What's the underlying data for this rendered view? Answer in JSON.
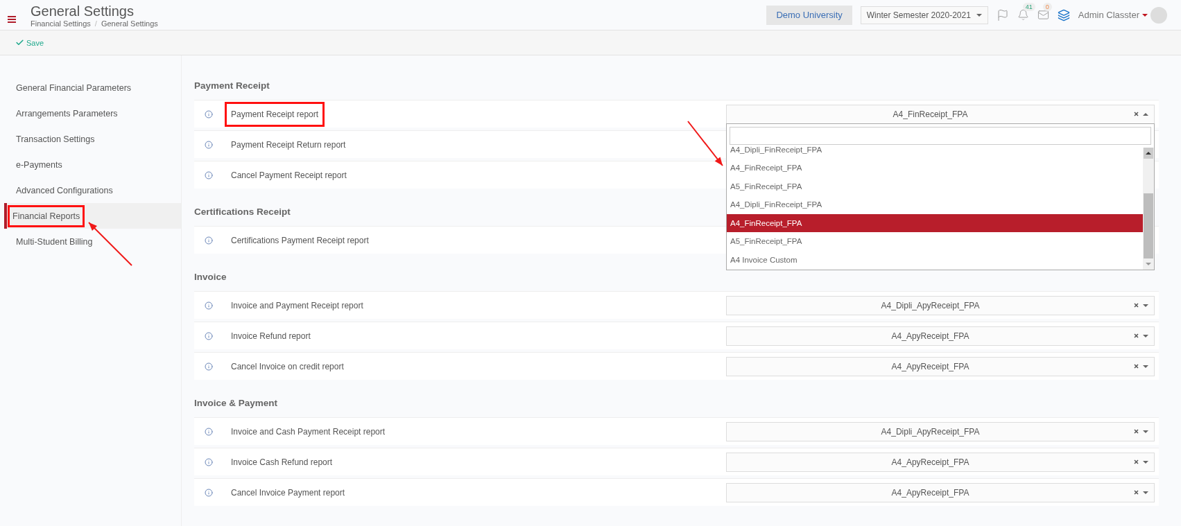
{
  "header": {
    "title": "General Settings",
    "breadcrumb": [
      "Financial Settings",
      "General Settings"
    ],
    "breadcrumb_separator": "/",
    "institution": "Demo University",
    "semester": "Winter Semester 2020-2021",
    "notifications": "41",
    "messages": "0",
    "user": "Admin Classter"
  },
  "toolbar": {
    "save": "Save"
  },
  "sidebar": {
    "items": [
      {
        "label": "General Financial Parameters",
        "selected": false,
        "highlighted": false
      },
      {
        "label": "Arrangements Parameters",
        "selected": false,
        "highlighted": false
      },
      {
        "label": "Transaction Settings",
        "selected": false,
        "highlighted": false
      },
      {
        "label": "e-Payments",
        "selected": false,
        "highlighted": false
      },
      {
        "label": "Advanced Configurations",
        "selected": false,
        "highlighted": false
      },
      {
        "label": "Financial Reports",
        "selected": true,
        "highlighted": true
      },
      {
        "label": "Multi-Student Billing",
        "selected": false,
        "highlighted": false
      }
    ]
  },
  "sections": [
    {
      "title": "Payment Receipt",
      "rows": [
        {
          "label": "Payment Receipt report",
          "highlighted": true,
          "value": "A4_FinReceipt_FPA",
          "open": true,
          "dropdown": {
            "options": [
              {
                "label": "A4_Dipli_FinReceipt_FPA",
                "selected": false
              },
              {
                "label": "A4_FinReceipt_FPA",
                "selected": false
              },
              {
                "label": "A5_FinReceipt_FPA",
                "selected": false
              },
              {
                "label": "A4_Dipli_FinReceipt_FPA",
                "selected": false
              },
              {
                "label": "A4_FinReceipt_FPA",
                "selected": true
              },
              {
                "label": "A5_FinReceipt_FPA",
                "selected": false
              },
              {
                "label": "A4 Invoice Custom",
                "selected": false
              }
            ]
          }
        },
        {
          "label": "Payment Receipt Return report",
          "highlighted": false
        },
        {
          "label": "Cancel Payment Receipt report",
          "highlighted": false
        }
      ]
    },
    {
      "title": "Certifications Receipt",
      "rows": [
        {
          "label": "Certifications Payment Receipt report",
          "highlighted": false
        }
      ]
    },
    {
      "title": "Invoice",
      "rows": [
        {
          "label": "Invoice and Payment Receipt report",
          "highlighted": false,
          "value": "A4_Dipli_ApyReceipt_FPA",
          "open": false
        },
        {
          "label": "Invoice Refund report",
          "highlighted": false,
          "value": "A4_ApyReceipt_FPA",
          "open": false
        },
        {
          "label": "Cancel Invoice on credit report",
          "highlighted": false,
          "value": "A4_ApyReceipt_FPA",
          "open": false
        }
      ]
    },
    {
      "title": "Invoice & Payment",
      "rows": [
        {
          "label": "Invoice and Cash Payment Receipt report",
          "highlighted": false,
          "value": "A4_Dipli_ApyReceipt_FPA",
          "open": false
        },
        {
          "label": "Invoice Cash Refund report",
          "highlighted": false,
          "value": "A4_ApyReceipt_FPA",
          "open": false
        },
        {
          "label": "Cancel Invoice Payment report",
          "highlighted": false,
          "value": "A4_ApyReceipt_FPA",
          "open": false
        }
      ]
    }
  ]
}
